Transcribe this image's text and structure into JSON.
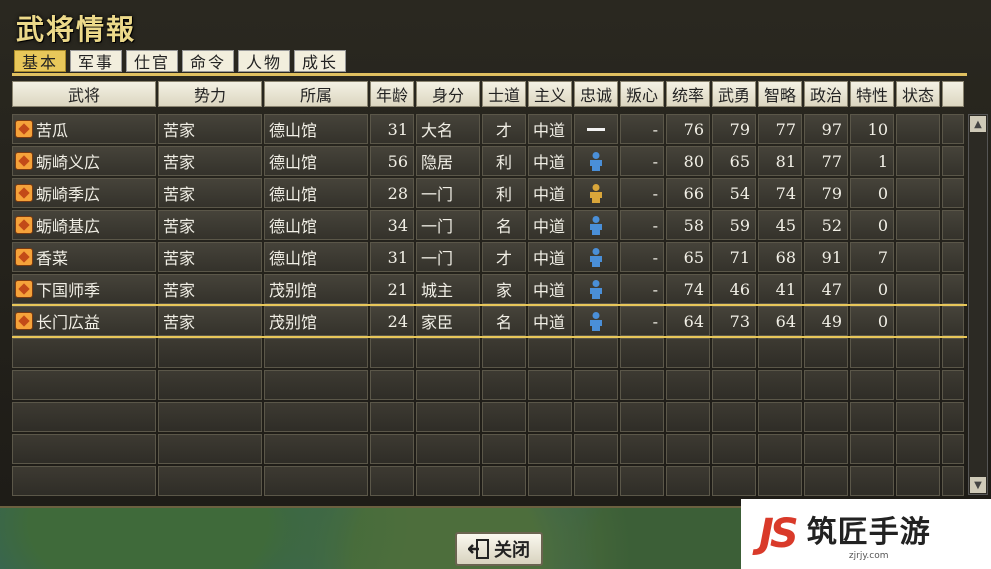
{
  "window": {
    "title": "武将情報"
  },
  "tabs": [
    {
      "label": "基本",
      "active": true
    },
    {
      "label": "军事",
      "active": false
    },
    {
      "label": "仕官",
      "active": false
    },
    {
      "label": "命令",
      "active": false
    },
    {
      "label": "人物",
      "active": false
    },
    {
      "label": "成长",
      "active": false
    }
  ],
  "columns": [
    "武将",
    "势力",
    "所属",
    "年龄",
    "身分",
    "士道",
    "主义",
    "忠诚",
    "叛心",
    "统率",
    "武勇",
    "智略",
    "政治",
    "特性",
    "状态",
    ""
  ],
  "rows": [
    {
      "name": "苦瓜",
      "faction": "苦家",
      "base": "德山馆",
      "age": "31",
      "status": "大名",
      "shido": "才",
      "ideology": "中道",
      "loyalty": "dash",
      "rebel": "-",
      "lead": "76",
      "war": "79",
      "intel": "77",
      "pol": "97",
      "trait": "10",
      "state": "",
      "selected": false
    },
    {
      "name": "蛎崎义広",
      "faction": "苦家",
      "base": "德山馆",
      "age": "56",
      "status": "隐居",
      "shido": "利",
      "ideology": "中道",
      "loyalty": "person-blue",
      "rebel": "-",
      "lead": "80",
      "war": "65",
      "intel": "81",
      "pol": "77",
      "trait": "1",
      "state": "",
      "selected": false
    },
    {
      "name": "蛎崎季広",
      "faction": "苦家",
      "base": "德山馆",
      "age": "28",
      "status": "一门",
      "shido": "利",
      "ideology": "中道",
      "loyalty": "person-gold",
      "rebel": "-",
      "lead": "66",
      "war": "54",
      "intel": "74",
      "pol": "79",
      "trait": "0",
      "state": "",
      "selected": false
    },
    {
      "name": "蛎崎基広",
      "faction": "苦家",
      "base": "德山馆",
      "age": "34",
      "status": "一门",
      "shido": "名",
      "ideology": "中道",
      "loyalty": "person-blue",
      "rebel": "-",
      "lead": "58",
      "war": "59",
      "intel": "45",
      "pol": "52",
      "trait": "0",
      "state": "",
      "selected": false
    },
    {
      "name": "香菜",
      "faction": "苦家",
      "base": "德山馆",
      "age": "31",
      "status": "一门",
      "shido": "才",
      "ideology": "中道",
      "loyalty": "person-blue",
      "rebel": "-",
      "lead": "65",
      "war": "71",
      "intel": "68",
      "pol": "91",
      "trait": "7",
      "state": "",
      "selected": false
    },
    {
      "name": "下国师季",
      "faction": "苦家",
      "base": "茂别馆",
      "age": "21",
      "status": "城主",
      "shido": "家",
      "ideology": "中道",
      "loyalty": "person-blue",
      "rebel": "-",
      "lead": "74",
      "war": "46",
      "intel": "41",
      "pol": "47",
      "trait": "0",
      "state": "",
      "selected": false
    },
    {
      "name": "长门広益",
      "faction": "苦家",
      "base": "茂别馆",
      "age": "24",
      "status": "家臣",
      "shido": "名",
      "ideology": "中道",
      "loyalty": "person-blue",
      "rebel": "-",
      "lead": "64",
      "war": "73",
      "intel": "64",
      "pol": "49",
      "trait": "0",
      "state": "",
      "selected": true
    }
  ],
  "empty_rows": 5,
  "icons": {
    "crest": "family-crest-icon",
    "loyal_blue": "#4a8fd8",
    "loyal_gold": "#d9a63a"
  },
  "footer": {
    "close_label": "关闭"
  },
  "watermark": {
    "text": "筑匠手游",
    "sub": "zjrjy.com",
    "logo": "JS"
  }
}
